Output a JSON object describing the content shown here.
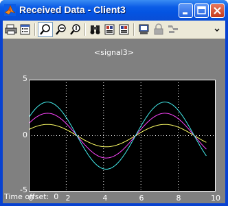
{
  "window": {
    "title": "Received Data - Client3"
  },
  "titlebar_buttons": [
    "minimize-icon",
    "maximize-icon",
    "close-icon"
  ],
  "toolbar": {
    "tools": [
      "print-icon",
      "parameters-icon",
      "zoom-icon",
      "zoom-x-icon",
      "zoom-y-icon",
      "binoculars-icon",
      "save-axes-icon",
      "restore-axes-icon",
      "floating-scope-icon",
      "lock-icon",
      "signal-selector-icon",
      "chevron-icon"
    ]
  },
  "plot": {
    "title": "<signal3>",
    "yticks": [
      "5",
      "0",
      "-5"
    ],
    "xticks": [
      "0",
      "2",
      "4",
      "6",
      "8",
      "10"
    ]
  },
  "status": {
    "label": "Time offset:",
    "value": "0"
  },
  "colors": {
    "background": "#808080",
    "axes": "#000000",
    "grid": "#ffffff",
    "series": [
      "#ffff66",
      "#ff44ff",
      "#44eeee"
    ]
  },
  "chart_data": {
    "type": "line",
    "title": "<signal3>",
    "xlabel": "",
    "ylabel": "",
    "xlim": [
      0,
      10
    ],
    "ylim": [
      -5,
      5
    ],
    "grid": true,
    "series": [
      {
        "color": "#ffff66",
        "amplitude": 1.0,
        "x": [
          0,
          0.5,
          1,
          1.5,
          2,
          2.5,
          3,
          3.5,
          4,
          4.5,
          5,
          5.5,
          6,
          6.5,
          7,
          7.5,
          8,
          8.5,
          9,
          9.5
        ],
        "y": [
          0.54,
          0.07,
          -0.42,
          -0.8,
          -0.99,
          -0.94,
          -0.65,
          -0.21,
          0.28,
          0.71,
          0.96,
          0.98,
          0.75,
          0.35,
          -0.15,
          -0.6,
          -0.91,
          -1.0,
          -0.84,
          -0.46
        ]
      },
      {
        "color": "#ff44ff",
        "amplitude": 2.0,
        "x": [
          0,
          0.5,
          1,
          1.5,
          2,
          2.5,
          3,
          3.5,
          4,
          4.5,
          5,
          5.5,
          6,
          6.5,
          7,
          7.5,
          8,
          8.5,
          9,
          9.5
        ],
        "y": [
          1.08,
          0.14,
          -0.83,
          -1.6,
          -1.98,
          -1.88,
          -1.3,
          -0.42,
          0.57,
          1.42,
          1.92,
          1.96,
          1.51,
          0.7,
          -0.29,
          -1.2,
          -1.82,
          -2.0,
          -1.68,
          -0.93
        ]
      },
      {
        "color": "#44eeee",
        "amplitude": 3.0,
        "x": [
          0,
          0.5,
          1,
          1.5,
          2,
          2.5,
          3,
          3.5,
          4,
          4.5,
          5,
          5.5,
          6,
          6.5,
          7,
          7.5,
          8,
          8.5,
          9,
          9.5
        ],
        "y": [
          1.62,
          0.21,
          -1.25,
          -2.4,
          -2.97,
          -2.82,
          -1.95,
          -0.63,
          0.85,
          2.13,
          2.88,
          2.94,
          2.26,
          1.05,
          -0.44,
          -1.8,
          -2.73,
          -2.99,
          -2.52,
          -1.39
        ]
      }
    ]
  }
}
